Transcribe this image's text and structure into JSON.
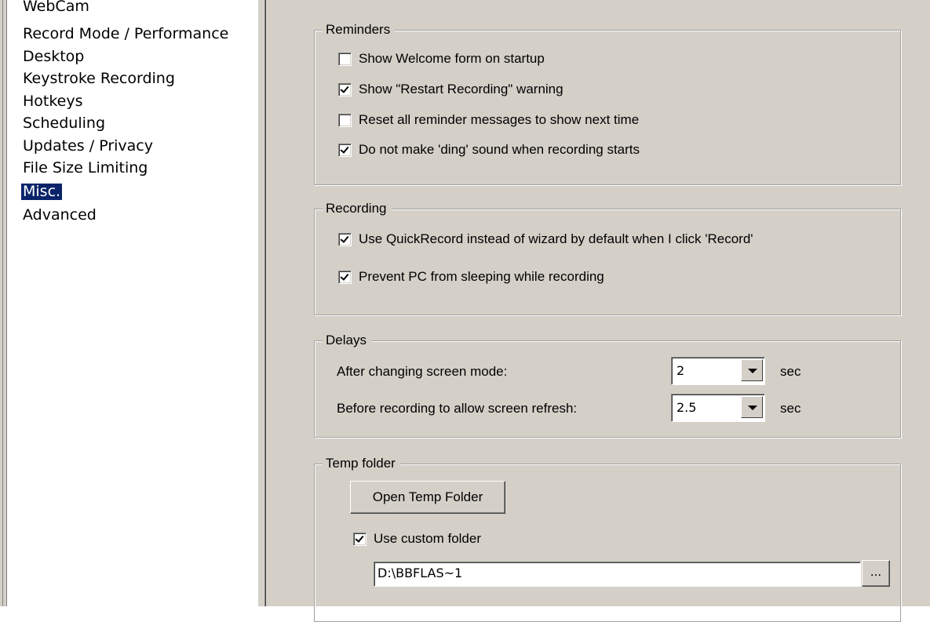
{
  "nav": {
    "items": [
      {
        "label": "WebCam"
      },
      {
        "label": "Record Mode / Performance"
      },
      {
        "label": "Desktop"
      },
      {
        "label": "Keystroke Recording"
      },
      {
        "label": "Hotkeys"
      },
      {
        "label": "Scheduling"
      },
      {
        "label": "Updates / Privacy"
      },
      {
        "label": "File Size Limiting"
      },
      {
        "label": "Misc."
      },
      {
        "label": "Advanced"
      }
    ],
    "selected": "Misc."
  },
  "reminders": {
    "title": "Reminders",
    "options": [
      {
        "label": "Show Welcome form on startup",
        "checked": false
      },
      {
        "label": "Show \"Restart Recording\" warning",
        "checked": true
      },
      {
        "label": "Reset all reminder messages to show next time",
        "checked": false
      },
      {
        "label": "Do not make 'ding' sound when recording starts",
        "checked": true
      }
    ]
  },
  "recording": {
    "title": "Recording",
    "options": [
      {
        "label": "Use QuickRecord instead of wizard by default when I click 'Record'",
        "checked": true
      },
      {
        "label": "Prevent PC from sleeping while recording",
        "checked": true
      }
    ]
  },
  "delays": {
    "title": "Delays",
    "rows": [
      {
        "label": "After changing screen mode:",
        "value": "2",
        "unit": "sec"
      },
      {
        "label": "Before recording to allow screen refresh:",
        "value": "2.5",
        "unit": "sec"
      }
    ]
  },
  "temp": {
    "title": "Temp folder",
    "open_button": "Open Temp Folder",
    "custom_label": "Use custom folder",
    "custom_checked": true,
    "path": "D:\\BBFLAS~1",
    "browse_button": "..."
  }
}
